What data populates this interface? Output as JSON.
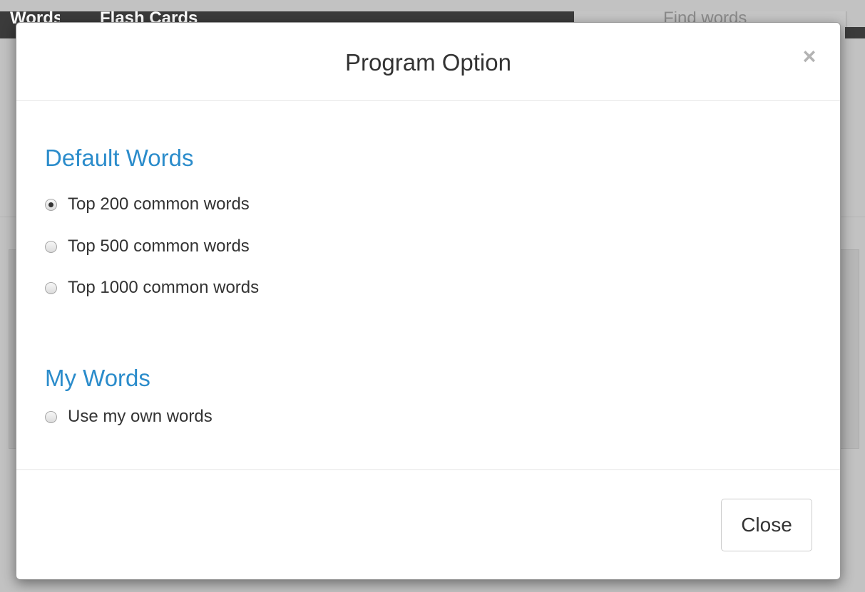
{
  "background": {
    "nav_items": [
      "Words",
      "Flash Cards"
    ],
    "search_placeholder": "Find words"
  },
  "modal": {
    "title": "Program Option",
    "close_symbol": "×",
    "sections": [
      {
        "heading": "Default Words",
        "options": [
          {
            "label": "Top 200 common words",
            "checked": true
          },
          {
            "label": "Top 500 common words",
            "checked": false
          },
          {
            "label": "Top 1000 common words",
            "checked": false
          }
        ]
      },
      {
        "heading": "My Words",
        "options": [
          {
            "label": "Use my own words",
            "checked": false
          }
        ]
      }
    ],
    "footer": {
      "close_label": "Close"
    }
  },
  "colors": {
    "heading_blue": "#2b8ccb",
    "text": "#333333",
    "navbar": "#3b3b3b"
  }
}
